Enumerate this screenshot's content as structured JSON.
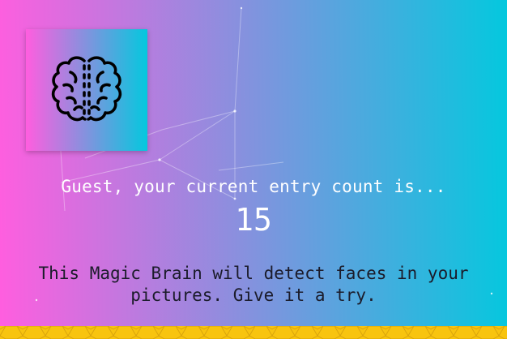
{
  "app": {
    "logo_icon": "brain-icon"
  },
  "rank": {
    "message": "Guest, your current entry count is...",
    "count": "15"
  },
  "description": {
    "line1": "This Magic Brain will detect faces in your",
    "line2": "pictures. Give it a try."
  },
  "colors": {
    "gradient_start": "#ff5edf",
    "gradient_end": "#04c8de",
    "bottom_strip": "#f8c40f"
  }
}
